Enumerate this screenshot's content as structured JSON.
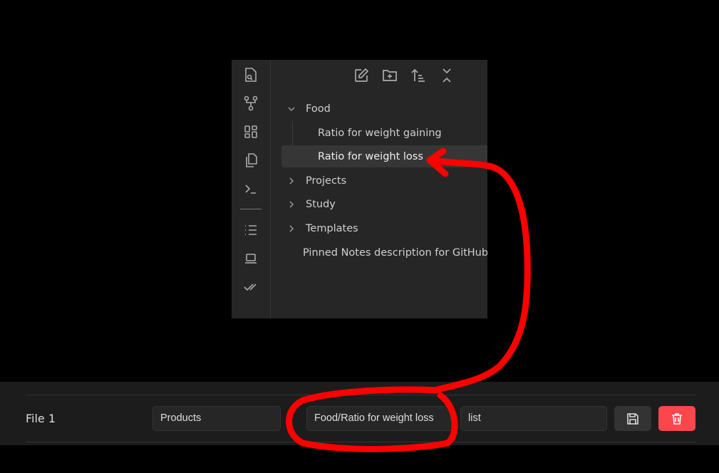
{
  "sidebar_ribbon": {
    "icons": [
      "search-file-icon",
      "graph-icon",
      "dashboard-icon",
      "copy-files-icon",
      "terminal-icon",
      "list-icon",
      "laptop-icon",
      "double-check-icon"
    ]
  },
  "toolbar": {
    "icons": [
      "new-note-icon",
      "new-folder-icon",
      "sort-icon",
      "collapse-all-icon"
    ]
  },
  "tree": {
    "items": [
      {
        "label": "Food",
        "type": "folder",
        "expanded": true
      },
      {
        "label": "Ratio for weight gaining",
        "type": "file"
      },
      {
        "label": "Ratio for weight loss",
        "type": "file",
        "selected": true
      },
      {
        "label": "Projects",
        "type": "folder",
        "expanded": false
      },
      {
        "label": "Study",
        "type": "folder",
        "expanded": false
      },
      {
        "label": "Templates",
        "type": "folder",
        "expanded": false
      },
      {
        "label": "Pinned Notes description for GitHub",
        "type": "file"
      }
    ]
  },
  "settings_row": {
    "label": "File 1",
    "field1": "Products",
    "field2": "Food/Ratio for weight loss",
    "field3": "list",
    "save_icon": "save-icon",
    "delete_icon": "trash-icon",
    "delete_color": "#fb464c"
  },
  "annotation_color": "#ff0000"
}
